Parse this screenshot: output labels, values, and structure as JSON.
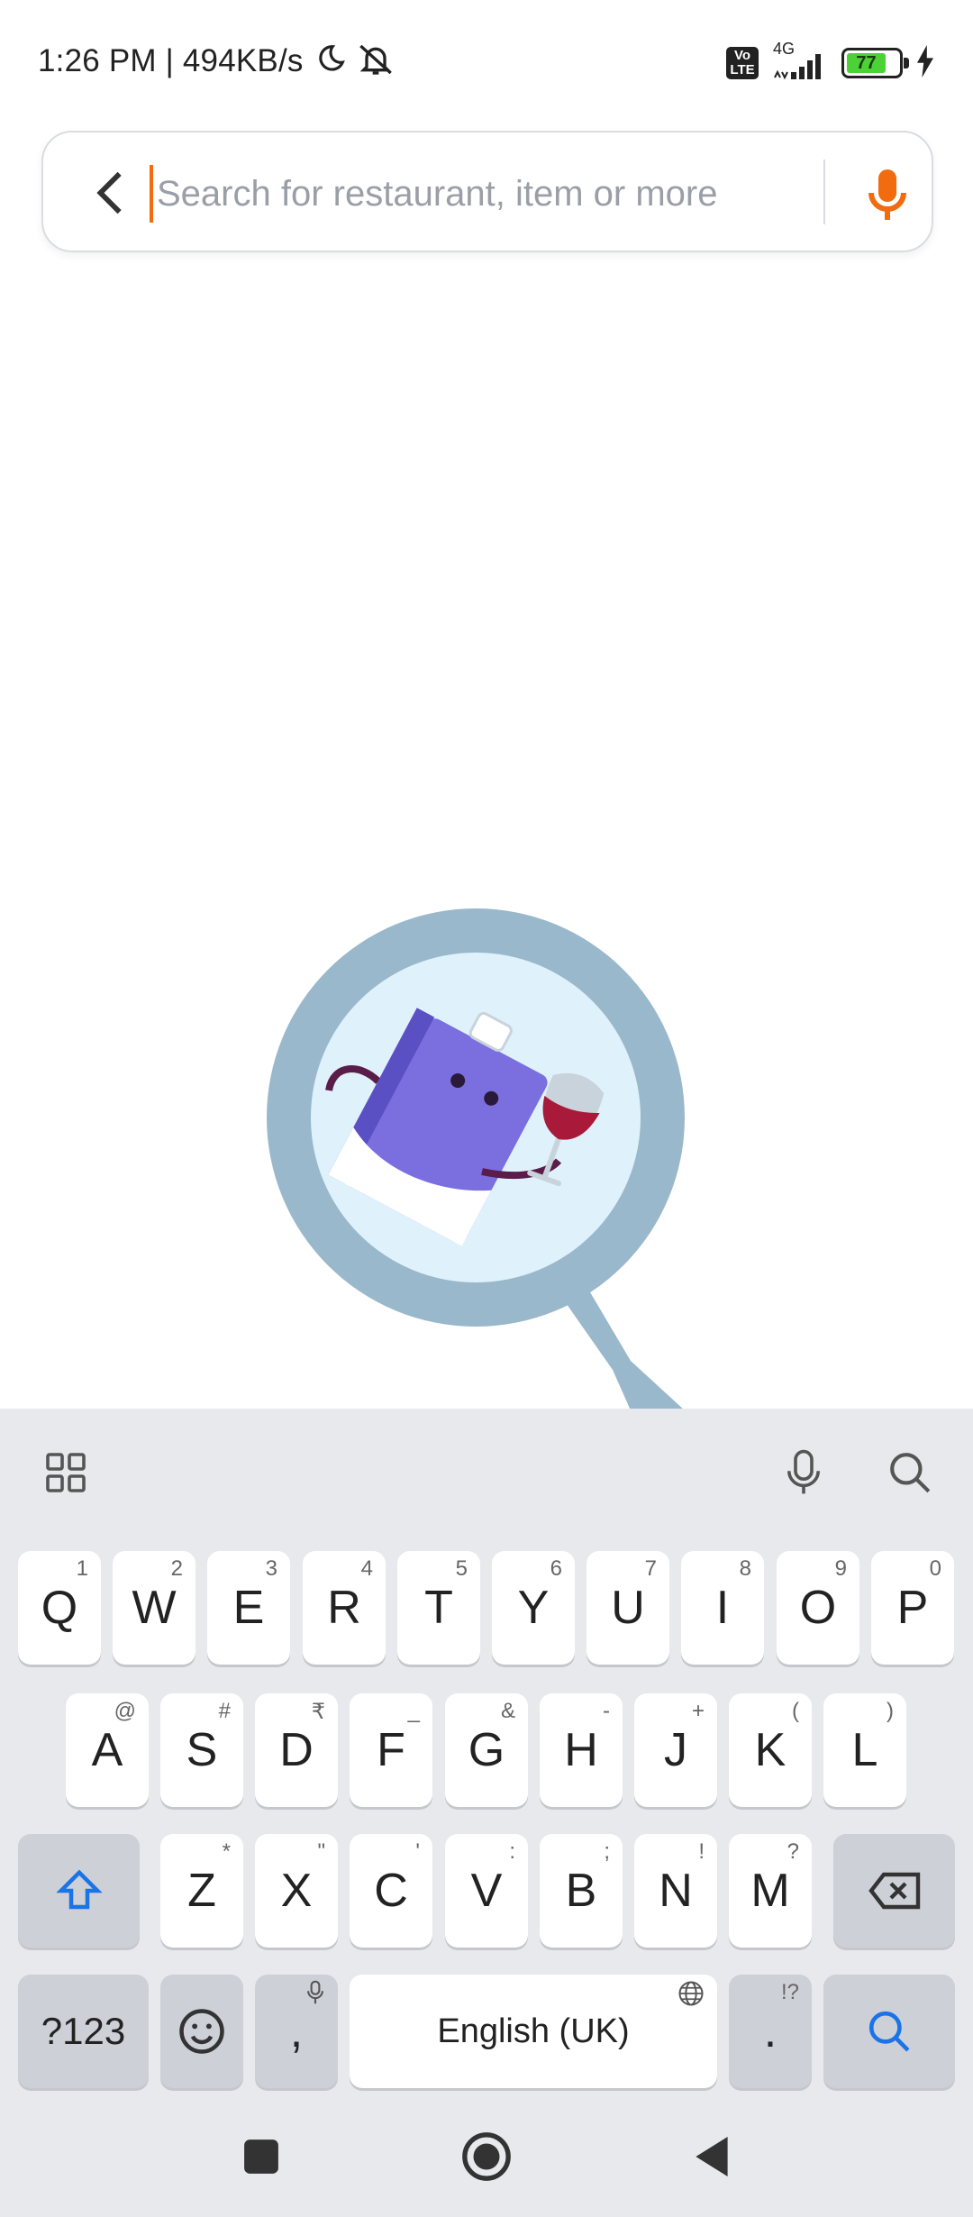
{
  "status_bar": {
    "time_speed": "1:26 PM | 494KB/s",
    "volte": "Vo LTE",
    "network": "4G",
    "battery": "77"
  },
  "search": {
    "placeholder": "Search for restaurant, item or more",
    "value": ""
  },
  "colors": {
    "accent": "#f26b0f",
    "magnifier": "#9ab8cc",
    "lens": "#dff2fb",
    "can": "#7b6fe0",
    "wine": "#a8193a"
  },
  "keyboard": {
    "row1": [
      {
        "key": "Q",
        "hint": "1"
      },
      {
        "key": "W",
        "hint": "2"
      },
      {
        "key": "E",
        "hint": "3"
      },
      {
        "key": "R",
        "hint": "4"
      },
      {
        "key": "T",
        "hint": "5"
      },
      {
        "key": "Y",
        "hint": "6"
      },
      {
        "key": "U",
        "hint": "7"
      },
      {
        "key": "I",
        "hint": "8"
      },
      {
        "key": "O",
        "hint": "9"
      },
      {
        "key": "P",
        "hint": "0"
      }
    ],
    "row2": [
      {
        "key": "A",
        "hint": "@"
      },
      {
        "key": "S",
        "hint": "#"
      },
      {
        "key": "D",
        "hint": "₹"
      },
      {
        "key": "F",
        "hint": "_"
      },
      {
        "key": "G",
        "hint": "&"
      },
      {
        "key": "H",
        "hint": "-"
      },
      {
        "key": "J",
        "hint": "+"
      },
      {
        "key": "K",
        "hint": "("
      },
      {
        "key": "L",
        "hint": ")"
      }
    ],
    "row3": [
      {
        "key": "Z",
        "hint": "*"
      },
      {
        "key": "X",
        "hint": "\""
      },
      {
        "key": "C",
        "hint": "'"
      },
      {
        "key": "V",
        "hint": ":"
      },
      {
        "key": "B",
        "hint": ";"
      },
      {
        "key": "N",
        "hint": "!"
      },
      {
        "key": "M",
        "hint": "?"
      }
    ],
    "symbols_label": "?123",
    "comma": ",",
    "space_label": "English (UK)",
    "period": ".",
    "period_hint": "!?"
  }
}
